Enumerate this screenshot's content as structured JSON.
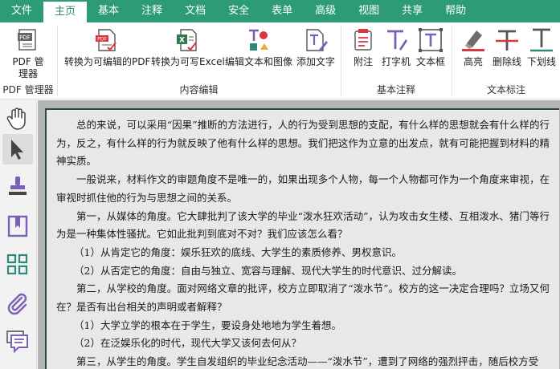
{
  "menubar": {
    "items": [
      {
        "label": "文件"
      },
      {
        "label": "主页"
      },
      {
        "label": "基本"
      },
      {
        "label": "注释"
      },
      {
        "label": "文档"
      },
      {
        "label": "安全"
      },
      {
        "label": "表单"
      },
      {
        "label": "高级"
      },
      {
        "label": "视图"
      },
      {
        "label": "共享"
      },
      {
        "label": "帮助"
      }
    ],
    "active": "主页"
  },
  "ribbon": {
    "pdf_manager": {
      "button_label": "PDF 管理器",
      "group_label": "PDF 管理器"
    },
    "content_edit": {
      "group_label": "内容编辑",
      "buttons": [
        {
          "label": "转换为可编辑的PDF"
        },
        {
          "label": "转换为可写Excel"
        },
        {
          "label": "编辑文本和图像"
        },
        {
          "label": "添加文字"
        }
      ]
    },
    "basic_annot": {
      "group_label": "基本注释",
      "buttons": [
        {
          "label": "附注"
        },
        {
          "label": "打字机"
        },
        {
          "label": "文本框"
        }
      ]
    },
    "text_mark": {
      "group_label": "文本标注",
      "buttons": [
        {
          "label": "高亮"
        },
        {
          "label": "删除线"
        },
        {
          "label": "下划线"
        }
      ]
    }
  },
  "colors": {
    "brand_green": "#2d9c76",
    "icon_red": "#d9363e",
    "icon_purple": "#7b5fb5",
    "icon_teal": "#2d8a7a"
  },
  "left_tools": [
    "hand-icon",
    "select-arrow-icon",
    "stamp-icon",
    "bookmark-icon",
    "thumbnails-icon",
    "attachment-icon",
    "comments-icon"
  ],
  "document": {
    "paragraphs": [
      {
        "text": "总的来说，可以采用“因果”推断的方法进行，人的行为受到思想的支配，有什么样的思想就会有什么样的行为，反之，有什么样的行为就反映了他有什么样的思想。我们把这作为立意的出发点，就有可能把握到材料的精神实质。"
      },
      {
        "text": "一般说来，材料作文的审题角度不是唯一的，如果出现多个人物，每一个人物都可作为一个角度来审视，在审视时抓住他的行为与思想之间的关系。"
      },
      {
        "text": "第一，从媒体的角度。它大肆批判了该大学的毕业“泼水狂欢活动”，认为攻击女生楼、互相泼水、猪门等行为是一种集体性骚扰。它如此批判到底对不对？我们应该怎么看？"
      },
      {
        "text": "（1）从肯定它的角度：娱乐狂欢的底线、大学生的素质修养、男权意识。"
      },
      {
        "text": "（2）从否定它的角度：自由与独立、宽容与理解、现代大学生的时代意识、过分解读。"
      },
      {
        "text": "第二，从学校的角度。面对网络文章的批评，校方立即取消了“泼水节”。校方的这一决定合理吗？立场又何在？是否有出台相关的声明或者解释？"
      },
      {
        "text": "（1）大学立学的根本在于学生，要设身处地地为学生着想。"
      },
      {
        "text": "（2）在泛娱乐化的时代，现代大学又该何去何从？"
      },
      {
        "text": "第三，从学生的角度。学生自发组织的毕业纪念活动——“泼水节”，遭到了网络的强烈抨击，随后校方受"
      }
    ]
  }
}
